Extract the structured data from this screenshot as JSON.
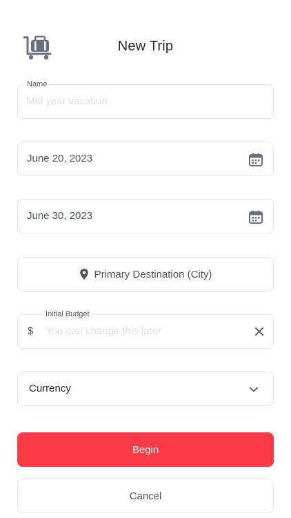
{
  "header": {
    "title": "New Trip",
    "logo_icon": "luggage-cart-icon"
  },
  "form": {
    "name": {
      "label": "Name",
      "placeholder": "Mid year vacation",
      "value": ""
    },
    "start_date": {
      "value": "June 20, 2023",
      "icon": "calendar-icon"
    },
    "end_date": {
      "value": "June 30, 2023",
      "icon": "calendar-icon"
    },
    "destination": {
      "label": "Primary Destination (City)",
      "icon": "map-pin-icon"
    },
    "budget": {
      "label": "Initial Budget",
      "prefix": "$",
      "placeholder": "You can change this later",
      "value": "",
      "clear_icon": "close-icon"
    },
    "currency": {
      "label": "Currency",
      "icon": "chevron-down-icon"
    }
  },
  "actions": {
    "begin_label": "Begin",
    "cancel_label": "Cancel"
  },
  "colors": {
    "primary": "#fb3a48",
    "border": "#e3e6eb",
    "text": "#4b5563",
    "icon": "#667085"
  }
}
